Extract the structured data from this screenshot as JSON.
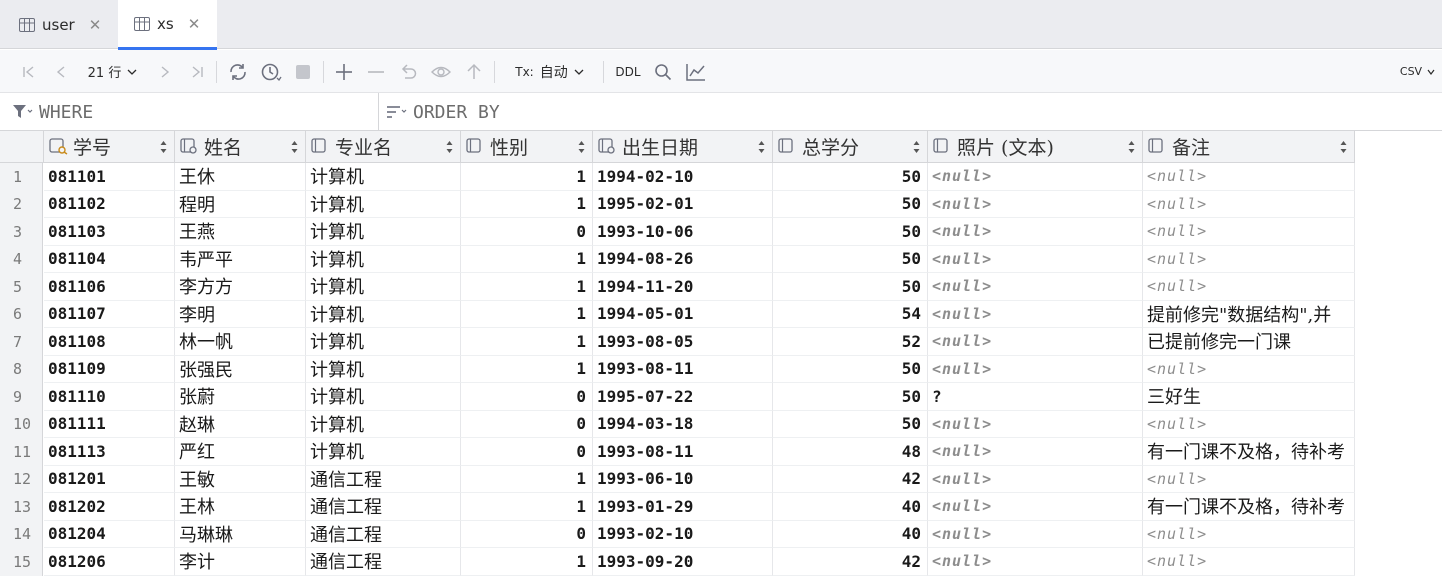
{
  "tabs": [
    {
      "label": "user",
      "active": false
    },
    {
      "label": "xs",
      "active": true
    }
  ],
  "toolbar": {
    "rows_count": "21 行",
    "tx_label": "Tx:",
    "tx_mode": "自动",
    "ddl_label": "DDL",
    "export_format": "CSV"
  },
  "filter": {
    "where": "WHERE",
    "order_by": "ORDER BY"
  },
  "columns": [
    "学号",
    "姓名",
    "专业名",
    "性别",
    "出生日期",
    "总学分",
    "照片 (文本)",
    "备注"
  ],
  "null_text": "<null>",
  "rows": [
    [
      "1",
      "081101",
      "王休",
      "计算机",
      "1",
      "1994-02-10",
      "50",
      null,
      null
    ],
    [
      "2",
      "081102",
      "程明",
      "计算机",
      "1",
      "1995-02-01",
      "50",
      null,
      null
    ],
    [
      "3",
      "081103",
      "王燕",
      "计算机",
      "0",
      "1993-10-06",
      "50",
      null,
      null
    ],
    [
      "4",
      "081104",
      "韦严平",
      "计算机",
      "1",
      "1994-08-26",
      "50",
      null,
      null
    ],
    [
      "5",
      "081106",
      "李方方",
      "计算机",
      "1",
      "1994-11-20",
      "50",
      null,
      null
    ],
    [
      "6",
      "081107",
      "李明",
      "计算机",
      "1",
      "1994-05-01",
      "54",
      null,
      "提前修完\"数据结构\",并"
    ],
    [
      "7",
      "081108",
      "林一帆",
      "计算机",
      "1",
      "1993-08-05",
      "52",
      null,
      "已提前修完一门课"
    ],
    [
      "8",
      "081109",
      "张强民",
      "计算机",
      "1",
      "1993-08-11",
      "50",
      null,
      null
    ],
    [
      "9",
      "081110",
      "张蔚",
      "计算机",
      "0",
      "1995-07-22",
      "50",
      "?",
      "三好生"
    ],
    [
      "10",
      "081111",
      "赵琳",
      "计算机",
      "0",
      "1994-03-18",
      "50",
      null,
      null
    ],
    [
      "11",
      "081113",
      "严红",
      "计算机",
      "0",
      "1993-08-11",
      "48",
      null,
      "有一门课不及格，待补考"
    ],
    [
      "12",
      "081201",
      "王敏",
      "通信工程",
      "1",
      "1993-06-10",
      "42",
      null,
      null
    ],
    [
      "13",
      "081202",
      "王林",
      "通信工程",
      "1",
      "1993-01-29",
      "40",
      null,
      "有一门课不及格，待补考"
    ],
    [
      "14",
      "081204",
      "马琳琳",
      "通信工程",
      "0",
      "1993-02-10",
      "40",
      null,
      null
    ],
    [
      "15",
      "081206",
      "李计",
      "通信工程",
      "1",
      "1993-09-20",
      "42",
      null,
      null
    ]
  ]
}
